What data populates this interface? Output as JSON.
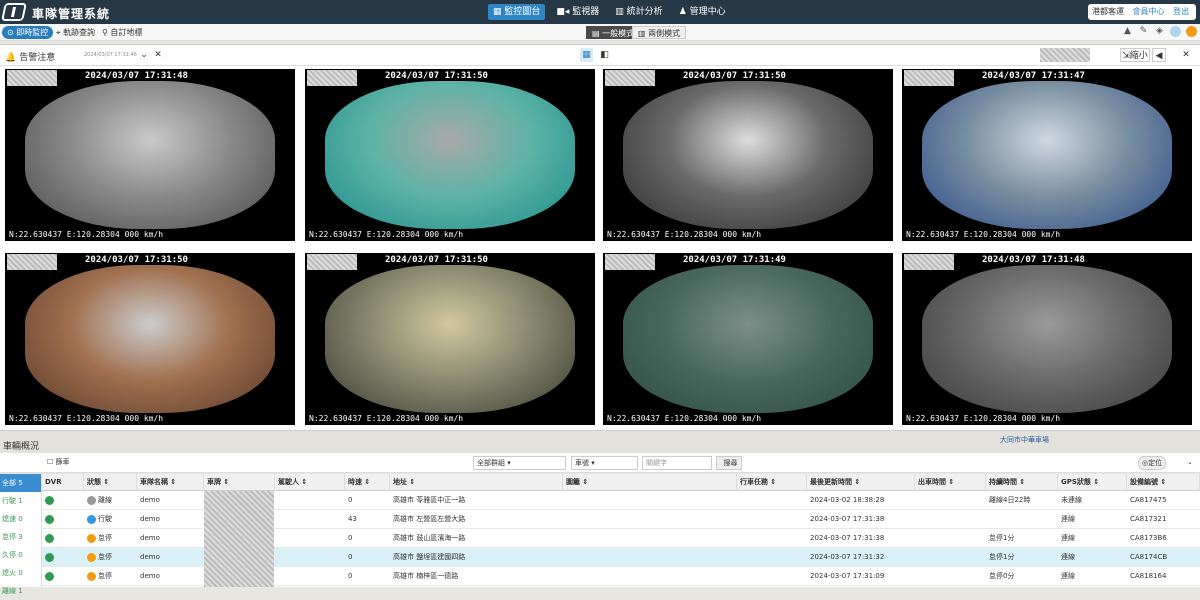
{
  "header": {
    "app_title": "車隊管理系統",
    "nav": [
      "監控圖台",
      "監視器",
      "統計分析",
      "管理中心"
    ],
    "user_name": "港都客運",
    "user_link1": "會員中心",
    "user_link2": "登出"
  },
  "toolbar": {
    "realtime": "即時監控",
    "track": "軌跡查詢",
    "map": "自訂地標",
    "mode_normal": "一般模式",
    "mode_split": "兩側模式"
  },
  "popup": {
    "title": "告警注意",
    "date": "2024/03/07 17:31:46",
    "shrink": "縮小"
  },
  "cameras": [
    {
      "ts": "2024/03/07 17:31:48",
      "gps": "N:22.630437  E:120.28304  000  km/h",
      "scene": "parking"
    },
    {
      "ts": "2024/03/07 17:31:50",
      "gps": "N:22.630437  E:120.28304  000  km/h",
      "scene": "street"
    },
    {
      "ts": "2024/03/07  17:31:50",
      "gps": "N:22.630437  E:120.28304  000  km/h",
      "scene": "driver"
    },
    {
      "ts": "2024/03/07  17:31:47",
      "gps": "N:22.630437  E:120.28304  000  km/h",
      "scene": "road"
    },
    {
      "ts": "2024/03/07  17:31:50",
      "gps": "N:22.630437  E:120.28304  000  km/h",
      "scene": "cabin"
    },
    {
      "ts": "2024/03/07  17:31:50",
      "gps": "N:22.630437  E:120.28304  000  km/h",
      "scene": "door"
    },
    {
      "ts": "2024/03/07  17:31:49",
      "gps": "N:22.630437  E:120.28304  000  km/h",
      "scene": "seats"
    },
    {
      "ts": "2024/03/07  17:31:48",
      "gps": "N:22.630437  E:120.28304  000  km/h",
      "scene": "aerial"
    }
  ],
  "map": {
    "label": "車輛概況",
    "station": "大同市中華車場"
  },
  "filters": {
    "checkbox": "篩車",
    "group": "全部群組",
    "plate": "車號",
    "keyword": "關鍵字",
    "search": "搜尋",
    "locate": "定位"
  },
  "left_counts": [
    "全部 5",
    "行駛 1",
    "熄速 0",
    "怠停 3",
    "久停 0",
    "熄火 0",
    "離線 1"
  ],
  "columns": [
    "DVR",
    "狀態",
    "車隊名稱",
    "車牌",
    "駕駛人",
    "時速",
    "地址",
    "圍籬",
    "行車任務",
    "最後更新時間",
    "出車時間",
    "持續時間",
    "GPS狀態",
    "設備編號"
  ],
  "rows": [
    {
      "status": "離線",
      "status_color": "#999999",
      "fleet": "demo",
      "speed": "0",
      "addr": "高雄市 苓雅區中正一路",
      "time": "2024-03-02 18:38:28",
      "dur": "離線4日22時",
      "gps": "未連線",
      "dev": "CA817475"
    },
    {
      "status": "行駛",
      "status_color": "#3498db",
      "fleet": "demo",
      "speed": "43",
      "addr": "高雄市 左營區左營大路",
      "time": "2024-03-07 17:31:38",
      "dur": "",
      "gps": "連線",
      "dev": "CA817321"
    },
    {
      "status": "怠停",
      "status_color": "#f39c12",
      "fleet": "demo",
      "speed": "0",
      "addr": "高雄市 鼓山區濱海一路",
      "time": "2024-03-07 17:31:38",
      "dur": "怠停1分",
      "gps": "連線",
      "dev": "CA8173B6"
    },
    {
      "status": "怠停",
      "status_color": "#f39c12",
      "fleet": "demo",
      "speed": "0",
      "addr": "高雄市 鹽埕區建國四路",
      "time": "2024-03-07 17:31:32",
      "dur": "怠停1分",
      "gps": "連線",
      "dev": "CA8174CB"
    },
    {
      "status": "怠停",
      "status_color": "#f39c12",
      "fleet": "demo",
      "speed": "0",
      "addr": "高雄市 楠梓區一德路",
      "time": "2024-03-07 17:31:09",
      "dur": "怠停0分",
      "gps": "連線",
      "dev": "CA818164"
    }
  ]
}
